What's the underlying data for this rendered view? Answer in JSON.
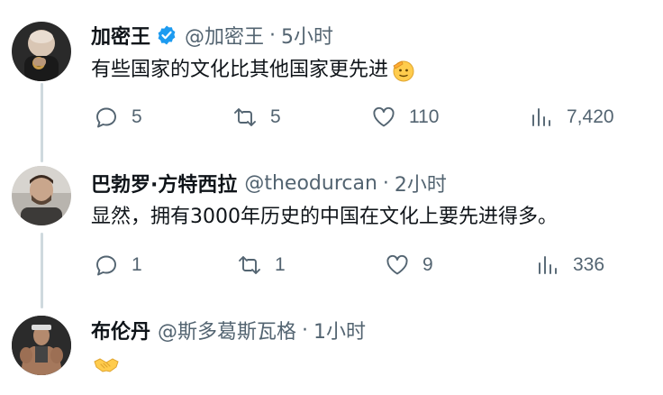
{
  "tweets": [
    {
      "display_name": "加密王",
      "handle": "@加密王",
      "separator": "·",
      "time": "5小时",
      "verified": true,
      "text": "有些国家的文化比其他国家更先进",
      "emoji": "saluting-face-emoji",
      "replies": "5",
      "retweets": "5",
      "likes": "110",
      "views": "7,420"
    },
    {
      "display_name": "巴勃罗·方特西拉",
      "handle": "@theodurcan",
      "separator": "·",
      "time": "2小时",
      "verified": false,
      "text": "显然，拥有3000年历史的中国在文化上要先进得多。",
      "replies": "1",
      "retweets": "1",
      "likes": "9",
      "views": "336"
    },
    {
      "display_name": "布伦丹",
      "handle": "@斯多葛斯瓦格",
      "separator": "·",
      "time": "1小时",
      "verified": false,
      "text": "",
      "emoji": "handshake-emoji"
    }
  ],
  "colors": {
    "text": "#0f1419",
    "secondary": "#536471",
    "verified": "#1d9bf0",
    "thread_line": "#cfd9de"
  }
}
